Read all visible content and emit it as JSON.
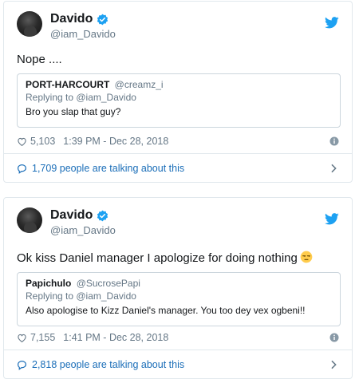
{
  "colors": {
    "twitter_blue": "#1da1f2",
    "link_blue": "#1b6eb8",
    "secondary_text": "#657786",
    "border": "#e1e8ed"
  },
  "tweets": [
    {
      "author_name": "Davido",
      "author_handle": "@iam_Davido",
      "text": "Nope ....",
      "quote": {
        "name": "PORT-HARCOURT",
        "handle": "@creamz_i",
        "replying": "Replying to @iam_Davido",
        "text": "Bro you slap that guy?"
      },
      "likes": "5,103",
      "timestamp": "1:39 PM - Dec 28, 2018",
      "talking": "1,709 people are talking about this"
    },
    {
      "author_name": "Davido",
      "author_handle": "@iam_Davido",
      "text": "Ok kiss Daniel manager I apologize for doing nothing",
      "emoji": "unamused-face-emoji",
      "quote": {
        "name": "Papichulo",
        "handle": "@SucrosePapi",
        "replying": "Replying to @iam_Davido",
        "text": "Also apologise to Kizz Daniel's manager. You too dey vex ogbeni!!"
      },
      "likes": "7,155",
      "timestamp": "1:41 PM - Dec 28, 2018",
      "talking": "2,818 people are talking about this"
    }
  ],
  "icons": [
    "verified-badge-icon",
    "twitter-bird-icon",
    "heart-icon",
    "info-icon",
    "speech-bubble-icon",
    "chevron-right-icon"
  ]
}
